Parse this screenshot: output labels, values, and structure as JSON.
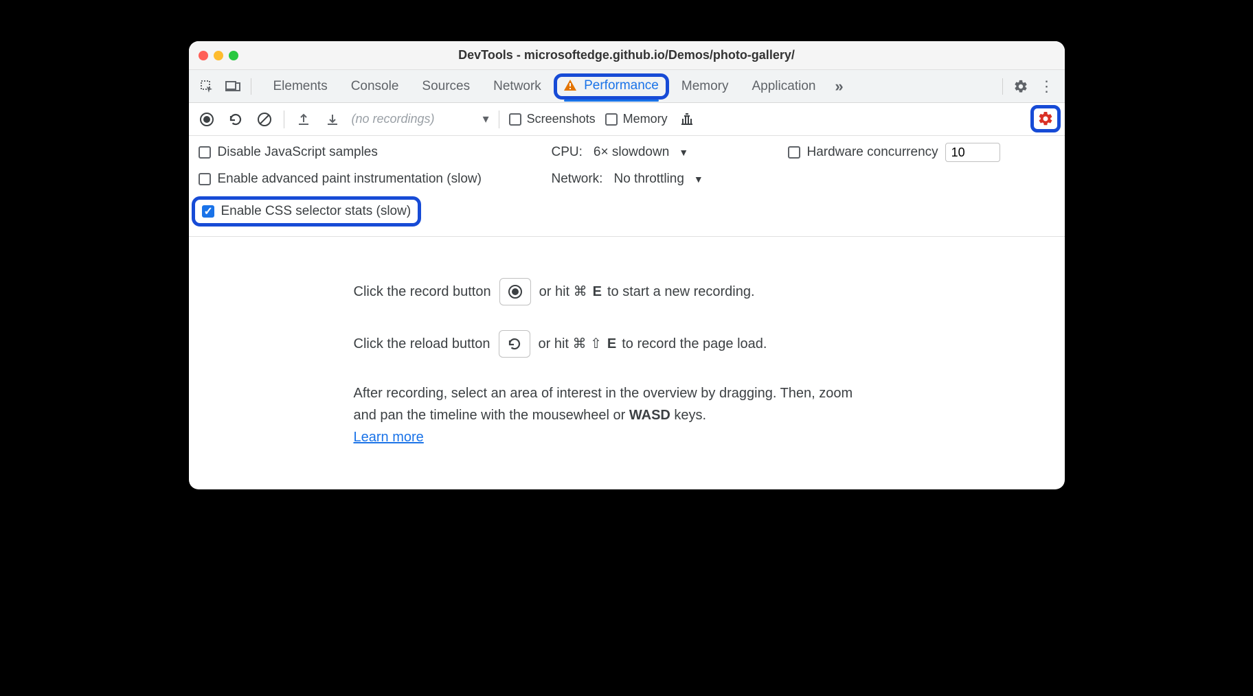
{
  "window": {
    "title": "DevTools - microsoftedge.github.io/Demos/photo-gallery/"
  },
  "tabs": {
    "elements": "Elements",
    "console": "Console",
    "sources": "Sources",
    "network": "Network",
    "performance": "Performance",
    "memory": "Memory",
    "application": "Application"
  },
  "toolbar": {
    "recordings_placeholder": "(no recordings)",
    "screenshots_label": "Screenshots",
    "memory_label": "Memory"
  },
  "settings": {
    "disable_js_samples": "Disable JavaScript samples",
    "enable_paint_instr": "Enable advanced paint instrumentation (slow)",
    "enable_css_stats": "Enable CSS selector stats (slow)",
    "cpu_label": "CPU:",
    "cpu_value": "6× slowdown",
    "network_label": "Network:",
    "network_value": "No throttling",
    "hw_concurrency_label": "Hardware concurrency",
    "hw_concurrency_value": "10"
  },
  "content": {
    "line1a": "Click the record button",
    "line1b": "or hit ⌘",
    "line1_key": "E",
    "line1c": "to start a new recording.",
    "line2a": "Click the reload button",
    "line2b": "or hit ⌘ ⇧",
    "line2_key": "E",
    "line2c": "to record the page load.",
    "line3": "After recording, select an area of interest in the overview by dragging. Then, zoom and pan the timeline with the mousewheel or ",
    "line3_bold": "WASD",
    "line3_tail": " keys.",
    "learn_more": "Learn more"
  }
}
